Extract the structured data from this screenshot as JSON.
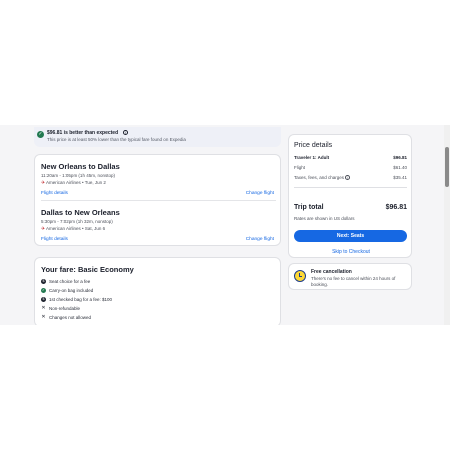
{
  "banner": {
    "title": "$96.81 is better than expected",
    "info_icon": "info-icon",
    "subtitle": "This price is at least 50% lower than the typical fare found on Expedia"
  },
  "flights": [
    {
      "route": "New Orleans to Dallas",
      "times": "11:20am - 1:05pm (1h 45m, nonstop)",
      "airline": "American Airlines • Tue, Jun 2",
      "details_link": "Flight details",
      "change_link": "Change flight"
    },
    {
      "route": "Dallas to New Orleans",
      "times": "5:30pm - 7:02pm (1h 32m, nonstop)",
      "airline": "American Airlines • Sat, Jun 6",
      "details_link": "Flight details",
      "change_link": "Change flight"
    }
  ],
  "fare": {
    "title": "Your fare: Basic Economy",
    "features": [
      {
        "icon": "dollar-icon",
        "text": "Seat choice for a fee"
      },
      {
        "icon": "check-icon",
        "text": "Carry-on bag included"
      },
      {
        "icon": "dollar-icon",
        "text": "1st checked bag for a fee: $100"
      },
      {
        "icon": "x-icon",
        "text": "Non-refundable"
      },
      {
        "icon": "x-icon",
        "text": "Changes not allowed"
      }
    ]
  },
  "price_details": {
    "title": "Price details",
    "traveler_label": "Traveler 1: Adult",
    "traveler_value": "$96.81",
    "flight_label": "Flight",
    "flight_value": "$61.40",
    "taxes_label": "Taxes, fees, and charges",
    "taxes_value": "$35.41",
    "total_label": "Trip total",
    "total_value": "$96.81",
    "rates_note": "Rates are shown in US dollars",
    "next_button": "Next: Seats",
    "skip_link": "Skip to Checkout"
  },
  "cancellation": {
    "title": "Free cancellation",
    "text": "There's no fee to cancel within 24 hours of booking."
  },
  "colors": {
    "accent": "#1668e3",
    "success": "#227950",
    "page_bg": "#f5f5f7"
  }
}
